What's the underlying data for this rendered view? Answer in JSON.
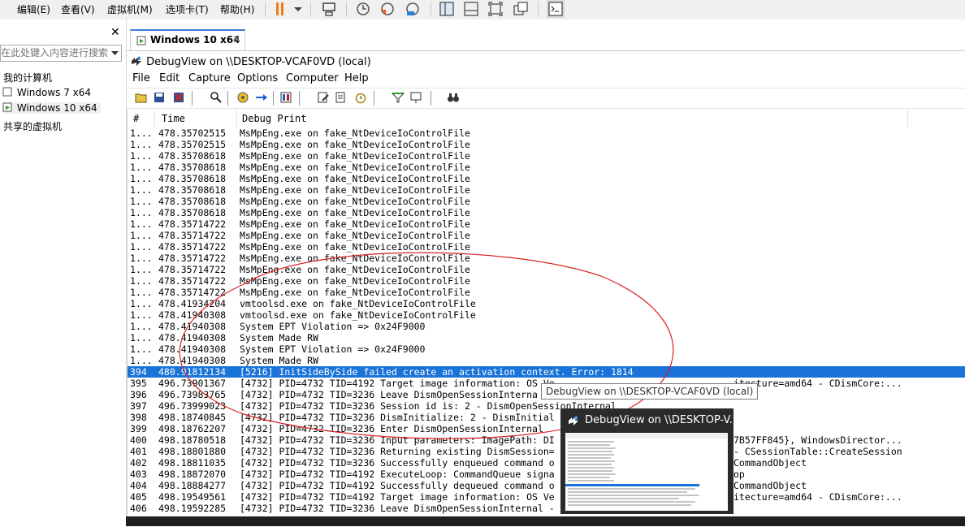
{
  "vmware": {
    "menus": [
      "编辑(E)",
      "查看(V)",
      "虚拟机(M)",
      "选项卡(T)",
      "帮助(H)"
    ]
  },
  "library": {
    "search_placeholder": "在此处键入内容进行搜索",
    "tree": {
      "root": "我的计算机",
      "vms": [
        "Windows 7 x64",
        "Windows 10 x64"
      ],
      "shared": "共享的虚拟机"
    }
  },
  "tab": {
    "label": "Windows 10 x64"
  },
  "debugview": {
    "title": "DebugView on \\\\DESKTOP-VCAF0VD (local)",
    "menus": [
      "File",
      "Edit",
      "Capture",
      "Options",
      "Computer",
      "Help"
    ],
    "columns": [
      "#",
      "Time",
      "Debug Print"
    ],
    "rows": [
      {
        "n": "1...",
        "t": "478.35702515",
        "m": "MsMpEng.exe on fake_NtDeviceIoControlFile"
      },
      {
        "n": "1...",
        "t": "478.35702515",
        "m": "MsMpEng.exe on fake_NtDeviceIoControlFile"
      },
      {
        "n": "1...",
        "t": "478.35708618",
        "m": "MsMpEng.exe on fake_NtDeviceIoControlFile"
      },
      {
        "n": "1...",
        "t": "478.35708618",
        "m": "MsMpEng.exe on fake_NtDeviceIoControlFile"
      },
      {
        "n": "1...",
        "t": "478.35708618",
        "m": "MsMpEng.exe on fake_NtDeviceIoControlFile"
      },
      {
        "n": "1...",
        "t": "478.35708618",
        "m": "MsMpEng.exe on fake_NtDeviceIoControlFile"
      },
      {
        "n": "1...",
        "t": "478.35708618",
        "m": "MsMpEng.exe on fake_NtDeviceIoControlFile"
      },
      {
        "n": "1...",
        "t": "478.35708618",
        "m": "MsMpEng.exe on fake_NtDeviceIoControlFile"
      },
      {
        "n": "1...",
        "t": "478.35714722",
        "m": "MsMpEng.exe on fake_NtDeviceIoControlFile"
      },
      {
        "n": "1...",
        "t": "478.35714722",
        "m": "MsMpEng.exe on fake_NtDeviceIoControlFile"
      },
      {
        "n": "1...",
        "t": "478.35714722",
        "m": "MsMpEng.exe on fake_NtDeviceIoControlFile"
      },
      {
        "n": "1...",
        "t": "478.35714722",
        "m": "MsMpEng.exe on fake_NtDeviceIoControlFile"
      },
      {
        "n": "1...",
        "t": "478.35714722",
        "m": "MsMpEng.exe on fake_NtDeviceIoControlFile"
      },
      {
        "n": "1...",
        "t": "478.35714722",
        "m": "MsMpEng.exe on fake_NtDeviceIoControlFile"
      },
      {
        "n": "1...",
        "t": "478.35714722",
        "m": "MsMpEng.exe on fake_NtDeviceIoControlFile"
      },
      {
        "n": "1...",
        "t": "478.41934204",
        "m": "vmtoolsd.exe on fake_NtDeviceIoControlFile"
      },
      {
        "n": "1...",
        "t": "478.41940308",
        "m": "vmtoolsd.exe on fake_NtDeviceIoControlFile"
      },
      {
        "n": "1...",
        "t": "478.41940308",
        "m": "System EPT Violation => 0x24F9000"
      },
      {
        "n": "1...",
        "t": "478.41940308",
        "m": "System Made RW"
      },
      {
        "n": "1...",
        "t": "478.41940308",
        "m": "System EPT Violation => 0x24F9000"
      },
      {
        "n": "1...",
        "t": "478.41940308",
        "m": "System Made RW"
      },
      {
        "n": "394",
        "t": "480.91812134",
        "m": "[5216] InitSideBySide failed create an activation context. Error: 1814",
        "selected": true
      },
      {
        "n": "395",
        "t": "496.73901367",
        "m": "[4732] PID=4732 TID=4192 Target image information: OS Ve"
      },
      {
        "n": "396",
        "t": "496.73983765",
        "m": "[4732] PID=4732 TID=3236 Leave DismOpenSessionInterna"
      },
      {
        "n": "397",
        "t": "496.73999023",
        "m": "[4732] PID=4732 TID=3236 Session id is: 2 - DismOpenSessionInternal"
      },
      {
        "n": "398",
        "t": "498.18740845",
        "m": "[4732] PID=4732 TID=3236 DismInitialize: 2 - DismInitial"
      },
      {
        "n": "399",
        "t": "498.18762207",
        "m": "[4732] PID=4732 TID=3236 Enter DismOpenSessionInternal"
      },
      {
        "n": "400",
        "t": "498.18780518",
        "m": "[4732] PID=4732 TID=3236 Input parameters: ImagePath: DI"
      },
      {
        "n": "401",
        "t": "498.18801880",
        "m": "[4732] PID=4732 TID=3236 Returning existing DismSession="
      },
      {
        "n": "402",
        "t": "498.18811035",
        "m": "[4732] PID=4732 TID=3236 Successfully enqueued command o"
      },
      {
        "n": "403",
        "t": "498.18872070",
        "m": "[4732] PID=4732 TID=4192 ExecuteLoop: CommandQueue signa"
      },
      {
        "n": "404",
        "t": "498.18884277",
        "m": "[4732] PID=4732 TID=4192 Successfully dequeued command o"
      },
      {
        "n": "405",
        "t": "498.19549561",
        "m": "[4732] PID=4732 TID=4192 Target image information: OS Ve"
      },
      {
        "n": "406",
        "t": "498.19592285",
        "m": "[4732] PID=4732 TID=3236 Leave DismOpenSessionInternal -"
      }
    ],
    "right_fragments": [
      {
        "row": 22,
        "text": "itecture=amd64 - CDismCore:..."
      },
      {
        "row": 27,
        "text": "7B57FF845}, WindowsDirector..."
      },
      {
        "row": 28,
        "text": "- CSessionTable::CreateSession"
      },
      {
        "row": 29,
        "text": "CommandObject"
      },
      {
        "row": 30,
        "text": "op"
      },
      {
        "row": 31,
        "text": "CommandObject"
      },
      {
        "row": 32,
        "text": "itecture=amd64 - CDismCore:..."
      }
    ]
  },
  "tooltip": "DebugView on \\\\DESKTOP-VCAF0VD (local)",
  "thumbnail": {
    "title": "DebugView on \\\\DESKTOP-V..."
  },
  "colors": {
    "selection": "#1a73d9",
    "annotation": "#d92020",
    "pause_orange": "#f07a1a"
  }
}
